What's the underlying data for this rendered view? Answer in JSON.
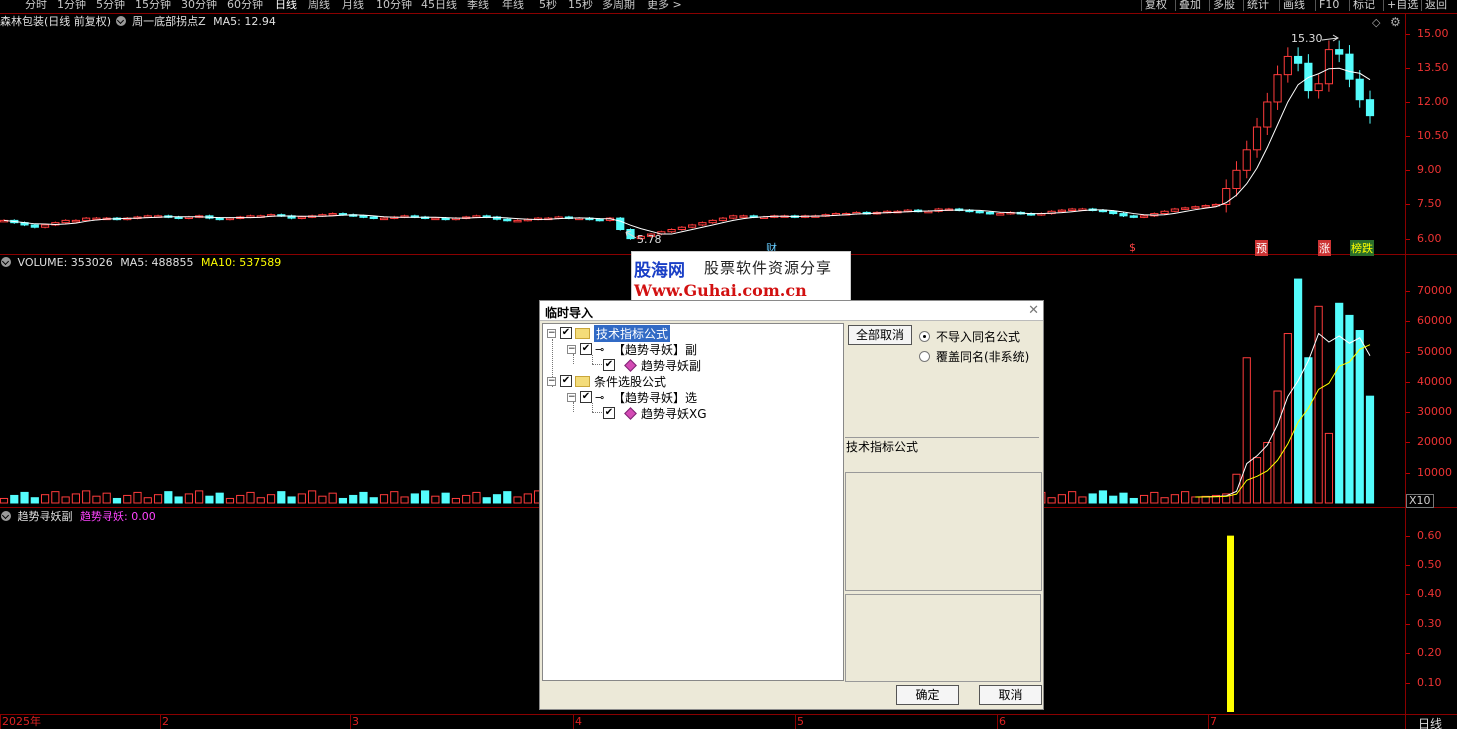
{
  "toolbar": {
    "periods": [
      "分时",
      "1分钟",
      "5分钟",
      "15分钟",
      "30分钟",
      "60分钟",
      "日线",
      "周线",
      "月线",
      "10分钟",
      "45日线",
      "季线",
      "年线",
      "5秒",
      "15秒",
      "多周期",
      "更多 >"
    ],
    "active_period": "日线",
    "right_buttons": [
      "复权",
      "叠加",
      "多股",
      "统计",
      "画线",
      "F10",
      "标记",
      "+自选",
      "返回"
    ]
  },
  "price_panel": {
    "stock_title": "森林包装(日线 前复权)",
    "indicator_name": "周一底部拐点Z",
    "ma5_label": "MA5: 12.94",
    "high_annotation": "15.30",
    "low_annotation": "5.78",
    "y_ticks": [
      "15.00",
      "13.50",
      "12.00",
      "10.50",
      "9.00",
      "7.50",
      "6.00"
    ],
    "markers": [
      "财",
      "$",
      "预",
      "涨",
      "榜跌"
    ]
  },
  "volume_panel": {
    "volume_label": "VOLUME: 353026",
    "ma5_label": "MA5: 488855",
    "ma10_label": "MA10: 537589",
    "y_ticks": [
      "70000",
      "60000",
      "50000",
      "40000",
      "30000",
      "20000",
      "10000"
    ],
    "unit": "X10"
  },
  "indicator_panel": {
    "name": "趋势寻妖副",
    "value_label": "趋势寻妖: 0.00",
    "y_ticks": [
      "0.60",
      "0.50",
      "0.40",
      "0.30",
      "0.20",
      "0.10"
    ]
  },
  "time_axis": {
    "labels": [
      "2025年",
      "2",
      "3",
      "4",
      "5",
      "6",
      "7"
    ],
    "period_label": "日线"
  },
  "dialog": {
    "title": "临时导入",
    "close_icon": "close-icon",
    "tree": [
      {
        "label": "技术指标公式",
        "level": 0,
        "type": "folder",
        "checked": true,
        "selected": true
      },
      {
        "label": "【趋势寻妖】副",
        "level": 1,
        "type": "key",
        "checked": true
      },
      {
        "label": "趋势寻妖副",
        "level": 2,
        "type": "gem",
        "checked": true
      },
      {
        "label": "条件选股公式",
        "level": 0,
        "type": "folder",
        "checked": true
      },
      {
        "label": "【趋势寻妖】选",
        "level": 1,
        "type": "key",
        "checked": true
      },
      {
        "label": "趋势寻妖XG",
        "level": 2,
        "type": "gem",
        "checked": true
      }
    ],
    "deselect_all_label": "全部取消",
    "radio_no_import_same": "不导入同名公式",
    "radio_overwrite_same": "覆盖同名(非系统)",
    "radio_selected": "不导入同名公式",
    "category_label": "技术指标公式",
    "ok_label": "确定",
    "cancel_label": "取消"
  },
  "watermark": {
    "logo": "股海网",
    "slogan": "股票软件资源分享",
    "url": "Www.Guhai.com.cn"
  },
  "colors": {
    "up": "#ff3c3c",
    "down": "#54fcfc",
    "ma": "#ffffff",
    "ma10": "#ffff00",
    "indicator": "#ffff00",
    "grid": "#8a0000"
  },
  "chart_data": [
    {
      "type": "candlestick",
      "title": "森林包装(日线 前复权)",
      "ylim": [
        5.5,
        15.6
      ],
      "close_series_approx": [
        6.8,
        6.7,
        6.6,
        6.5,
        6.6,
        6.7,
        6.8,
        6.8,
        6.9,
        6.9,
        6.9,
        6.85,
        6.9,
        6.95,
        7.0,
        7.0,
        6.95,
        6.9,
        6.95,
        7.0,
        6.9,
        6.85,
        6.9,
        6.95,
        7.0,
        7.0,
        7.05,
        7.0,
        6.9,
        6.95,
        7.0,
        7.05,
        7.1,
        7.05,
        7.0,
        6.95,
        6.9,
        6.9,
        6.95,
        7.0,
        6.95,
        6.9,
        6.9,
        6.85,
        6.9,
        6.95,
        7.0,
        6.95,
        6.85,
        6.8,
        6.8,
        6.85,
        6.9,
        6.9,
        6.95,
        6.9,
        6.9,
        6.85,
        6.8,
        6.9,
        6.4,
        6.0,
        6.1,
        6.2,
        6.3,
        6.4,
        6.5,
        6.6,
        6.7,
        6.8,
        6.9,
        7.0,
        7.0,
        6.95,
        6.95,
        7.0,
        7.0,
        6.95,
        7.0,
        7.0,
        7.05,
        7.1,
        7.1,
        7.15,
        7.1,
        7.15,
        7.2,
        7.2,
        7.25,
        7.2,
        7.2,
        7.3,
        7.3,
        7.25,
        7.2,
        7.15,
        7.1,
        7.1,
        7.15,
        7.1,
        7.05,
        7.1,
        7.2,
        7.25,
        7.3,
        7.3,
        7.25,
        7.2,
        7.1,
        7.0,
        6.95,
        7.0,
        7.1,
        7.2,
        7.3,
        7.35,
        7.4,
        7.45,
        7.5,
        8.2,
        9.0,
        9.9,
        10.9,
        12.0,
        13.2,
        14.0,
        13.7,
        12.5,
        12.8,
        14.3,
        14.1,
        13.0,
        12.1,
        11.4
      ],
      "high_label": 15.3,
      "low_label": 5.78,
      "ma5_last": 12.94
    },
    {
      "type": "bar",
      "title": "VOLUME",
      "ylim": [
        0,
        77000
      ],
      "values_tail": [
        2000,
        2200,
        2500,
        3000,
        9500,
        48000,
        15000,
        20000,
        37000,
        56000,
        74000,
        48000,
        65000,
        23000,
        66000,
        62000,
        57000,
        35302
      ],
      "last_volume": 353026,
      "ma5_last": 488855,
      "ma10_last": 537589
    },
    {
      "type": "bar",
      "title": "趋势寻妖副",
      "ylim": [
        0,
        0.66
      ],
      "signal_values": [
        0.6
      ],
      "last_value": 0.0
    }
  ]
}
